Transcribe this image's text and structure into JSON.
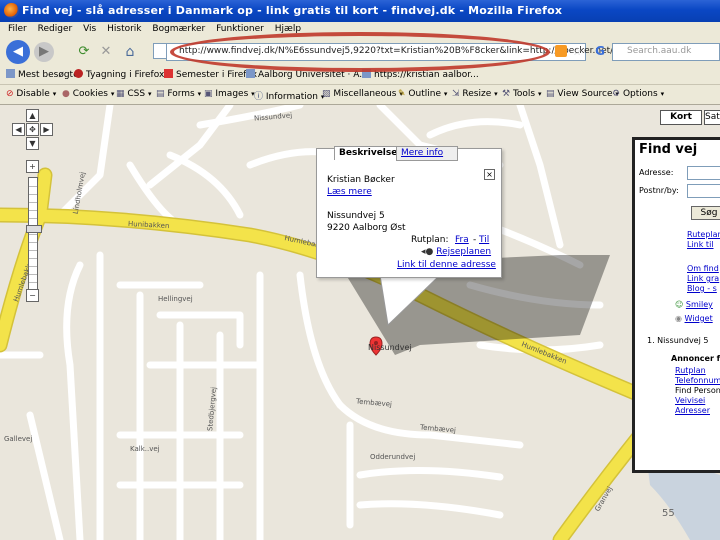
{
  "window": {
    "title": "Find vej - slå adresser i Danmark op - link gratis til kort - findvej.dk - Mozilla Firefox"
  },
  "menu": [
    "Filer",
    "Rediger",
    "Vis",
    "Historik",
    "Bogmærker",
    "Funktioner",
    "Hjælp"
  ],
  "nav": {
    "url": "http://www.findvej.dk/N%E6ssundvej5,9220?txt=Kristian%20B%F8cker&link=http://boecker.net/",
    "search_placeholder": "Search.aau.dk"
  },
  "bookmarks": [
    {
      "label": "Mest besøgte"
    },
    {
      "label": "Tyagning i Firefox"
    },
    {
      "label": "Semester i Firefox"
    },
    {
      "label": "Aalborg Universitet · A..."
    },
    {
      "label": "https://kristian aalbor..."
    }
  ],
  "devbar": [
    "Disable",
    "Cookies",
    "CSS",
    "Forms",
    "Images",
    "Information",
    "Miscellaneous",
    "Outline",
    "Resize",
    "Tools",
    "View Source",
    "Options"
  ],
  "map": {
    "streets": [
      "Nissundvej",
      "Hunibakken",
      "Humlebakken",
      "Humlebakken",
      "Hellingvej",
      "Humlebakken",
      "Tembævej",
      "Tembævej",
      "Odderundvej",
      "Gallevej",
      "Lindholmvej",
      "Kalk..vej",
      "Stedbjergvej",
      "Granvej"
    ],
    "marker_label": "Nissundvej",
    "zoom_level_fraction": 0.55
  },
  "infowindow": {
    "tab_active": "Beskrivelse",
    "tab_other": "Mere info",
    "name": "Kristian Bøcker",
    "more_link": "Læs mere",
    "address_line1": "Nissundvej 5",
    "address_line2": "9220 Aalborg Øst",
    "route_label": "Rutplan:",
    "route_from": "Fra",
    "route_to": "Til",
    "rejseplan": "Rejseplanen",
    "link_address": "Link til denne adresse"
  },
  "panel": {
    "tabs": [
      "Kort",
      "Satellit"
    ],
    "title": "Find vej",
    "address_label": "Adresse:",
    "postal_label": "Postnr/by:",
    "search_button": "Søg",
    "links": [
      "Ruteplan",
      "Link til"
    ],
    "links2": [
      "Om find",
      "Link gra",
      "Blog - s"
    ],
    "icons": [
      "Smiley",
      "Widget"
    ],
    "result": "1. Nissundvej 5",
    "ads_title": "Annoncer fr",
    "ads": [
      "Rutplan",
      "Telefonnumm",
      "Find Person",
      "Veivisei",
      "Adresser"
    ]
  },
  "slide_number": "55",
  "colors": {
    "annotation": "#c0392b",
    "road_major": "#f3e34a",
    "road_minor": "#ffffff"
  }
}
